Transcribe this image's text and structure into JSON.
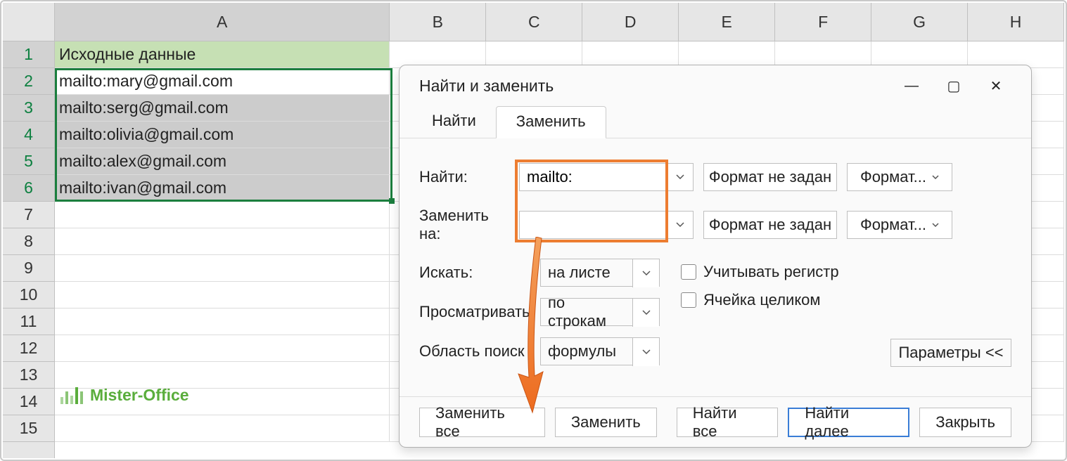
{
  "columns": [
    "A",
    "B",
    "C",
    "D",
    "E",
    "F",
    "G",
    "H"
  ],
  "row_numbers": [
    1,
    2,
    3,
    4,
    5,
    6,
    7,
    8,
    9,
    10,
    11,
    12,
    13,
    14,
    15
  ],
  "data": {
    "header": "Исходные данные",
    "rows": [
      "mailto:mary@gmail.com",
      "mailto:serg@gmail.com",
      "mailto:olivia@gmail.com",
      "mailto:alex@gmail.com",
      "mailto:ivan@gmail.com"
    ]
  },
  "dialog": {
    "title": "Найти и заменить",
    "tabs": {
      "find": "Найти",
      "replace": "Заменить"
    },
    "labels": {
      "find": "Найти:",
      "replace": "Заменить на:",
      "search": "Искать:",
      "look_in": "Просматривать",
      "scope": "Область поиск"
    },
    "values": {
      "find": "mailto:",
      "replace": "",
      "search": "на листе",
      "look_in": "по строкам",
      "scope": "формулы"
    },
    "format_not_set": "Формат не задан",
    "format_btn": "Формат...",
    "checkboxes": {
      "case": "Учитывать регистр",
      "whole": "Ячейка целиком"
    },
    "params_btn": "Параметры <<",
    "buttons": {
      "replace_all": "Заменить все",
      "replace": "Заменить",
      "find_all": "Найти все",
      "find_next": "Найти далее",
      "close": "Закрыть"
    }
  },
  "logo": "Mister-Office"
}
